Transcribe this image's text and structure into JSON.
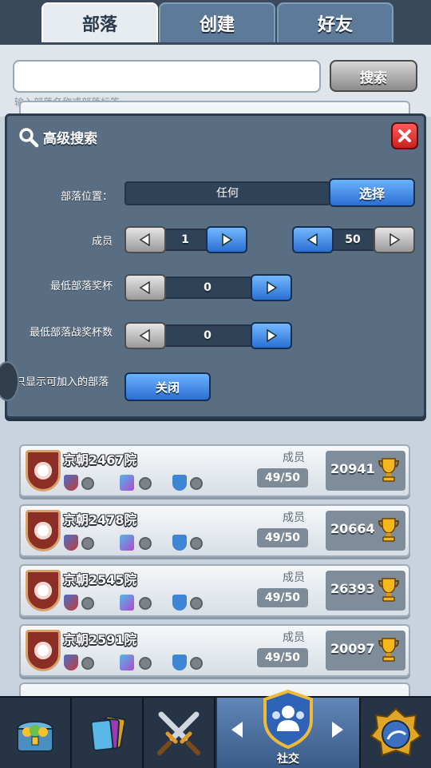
{
  "tabs": [
    {
      "label": "部落",
      "active": true
    },
    {
      "label": "创建",
      "active": false
    },
    {
      "label": "好友",
      "active": false
    }
  ],
  "search": {
    "value": "",
    "placeholder": "",
    "button_label": "搜索",
    "hint": "输入部落名称或部落标签"
  },
  "advanced": {
    "title": "高级搜索",
    "location_label": "部落位置：",
    "location_value": "任何",
    "select_label": "选择",
    "members_label": "成员",
    "members_min": "1",
    "members_max": "50",
    "min_trophies_label": "最低部落奖杯",
    "min_trophies_value": "0",
    "min_war_trophies_label": "最低部落战奖杯数",
    "min_war_trophies_value": "0",
    "joinable_label": "只显示可加入的部落",
    "joinable_value": "关闭"
  },
  "clans": [
    {
      "name": "京朝2467院",
      "members_label": "成员",
      "members": "49/50",
      "trophies": "20941"
    },
    {
      "name": "京朝2478院",
      "members_label": "成员",
      "members": "49/50",
      "trophies": "20664"
    },
    {
      "name": "京朝2545院",
      "members_label": "成员",
      "members": "49/50",
      "trophies": "26393"
    },
    {
      "name": "京朝2591院",
      "members_label": "成员",
      "members": "49/50",
      "trophies": "20097"
    }
  ],
  "bottom_nav": {
    "active_label": "社交",
    "items": [
      "shop-chest-icon",
      "cards-icon",
      "battle-swords-icon",
      "social-icon",
      "events-icon"
    ]
  },
  "colors": {
    "accent_blue": "#2b6fd3",
    "close_red": "#c8201f",
    "panel": "#5a6e83"
  }
}
